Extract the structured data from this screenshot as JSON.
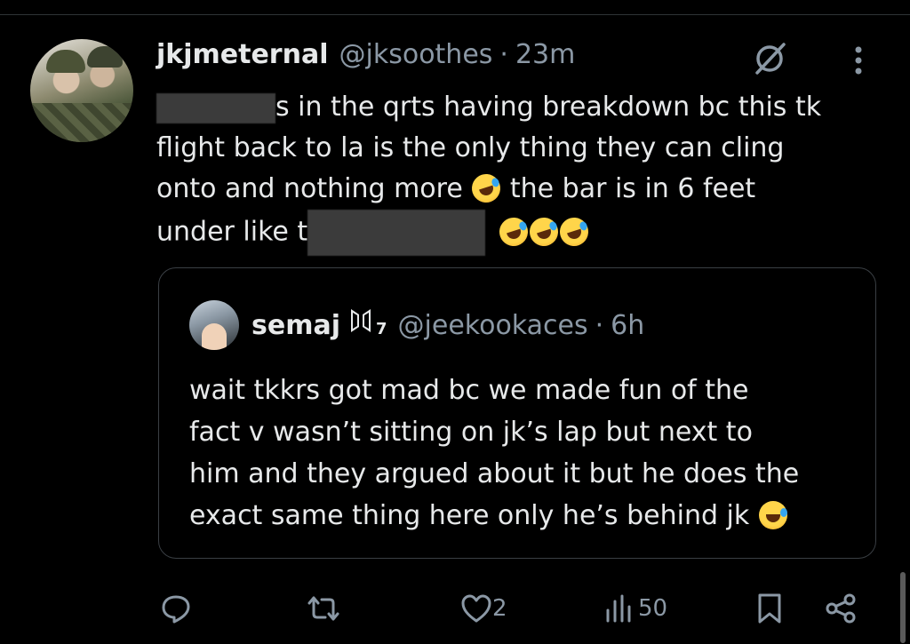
{
  "tweet": {
    "display_name": "jkjmeternal",
    "handle": "@jksoothes",
    "separator": "·",
    "time": "23m",
    "text_line1": "s in the qrts having breakdown bc this tk",
    "text_line2": "flight back to la is the only thing they can cling",
    "text_line3a": "onto and nothing more",
    "text_line3b": "the bar is in 6 feet",
    "text_line4a": "under like t"
  },
  "quote": {
    "display_name": "semaj",
    "badge_suffix": "7",
    "handle": "@jeekookaces",
    "separator": "·",
    "time": "6h",
    "text_line1": "wait tkkrs got mad bc we made fun of the",
    "text_line2": "fact v wasn’t sitting on jk’s lap but next to",
    "text_line3": "him and they argued about it but he does the",
    "text_line4": "exact same thing here only he’s behind jk"
  },
  "actions": {
    "reply_count": "",
    "retweet_count": "",
    "like_count": "2",
    "view_count": "50"
  },
  "icons": {
    "grok": "grok-icon",
    "more": "more-icon",
    "reply": "reply-icon",
    "retweet": "retweet-icon",
    "like": "heart-icon",
    "views": "views-icon",
    "bookmark": "bookmark-icon",
    "share": "share-icon"
  },
  "colors": {
    "background": "#000000",
    "text": "#e7e9ea",
    "muted": "#8b98a5",
    "border": "#3a3f44"
  }
}
